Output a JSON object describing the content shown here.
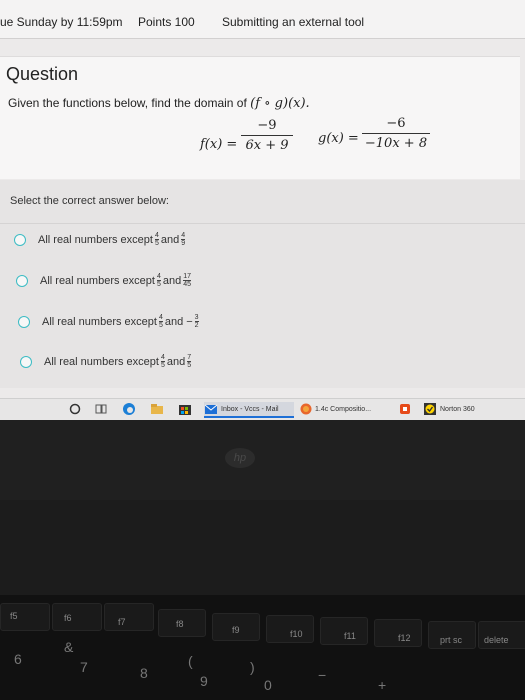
{
  "topbar": {
    "due": "ue Sunday by 11:59pm",
    "points": "Points 100",
    "submitting": "Submitting an external tool"
  },
  "question": {
    "title": "Question",
    "text": "Given the functions below, find the domain of ",
    "expr": "(f ∘ g)(x).",
    "f_label": "f(x) =",
    "f_num": "−9",
    "f_den": "6x + 9",
    "g_label": "g(x) =",
    "g_num": "−6",
    "g_den": "−10x + 8"
  },
  "answers": {
    "prompt": "Select the correct answer below:",
    "options": [
      {
        "text": "All real numbers except",
        "a_num": "4",
        "a_den": "5",
        "and": "and",
        "b_num": "4",
        "b_den": "9",
        "b_sign": ""
      },
      {
        "text": "All real numbers except",
        "a_num": "4",
        "a_den": "5",
        "and": "and",
        "b_num": "17",
        "b_den": "45",
        "b_sign": ""
      },
      {
        "text": "All real numbers except",
        "a_num": "4",
        "a_den": "5",
        "and": "and",
        "b_num": "3",
        "b_den": "2",
        "b_sign": "−"
      },
      {
        "text": "All real numbers except",
        "a_num": "4",
        "a_den": "5",
        "and": "and",
        "b_num": "7",
        "b_den": "5",
        "b_sign": ""
      }
    ]
  },
  "taskbar": {
    "inbox": "Inbox - Vccs - Mail",
    "composition": "1.4c Compositio...",
    "norton": "Norton 360"
  },
  "logo": "hp",
  "keys": {
    "f_row": [
      "f5",
      "f6",
      "f7",
      "f8",
      "f9",
      "f10",
      "f11",
      "f12",
      "prt sc",
      "delete"
    ],
    "num_row": [
      "6",
      "&",
      "7",
      "8",
      "(",
      "9",
      ")",
      "0",
      "−",
      "+"
    ]
  }
}
